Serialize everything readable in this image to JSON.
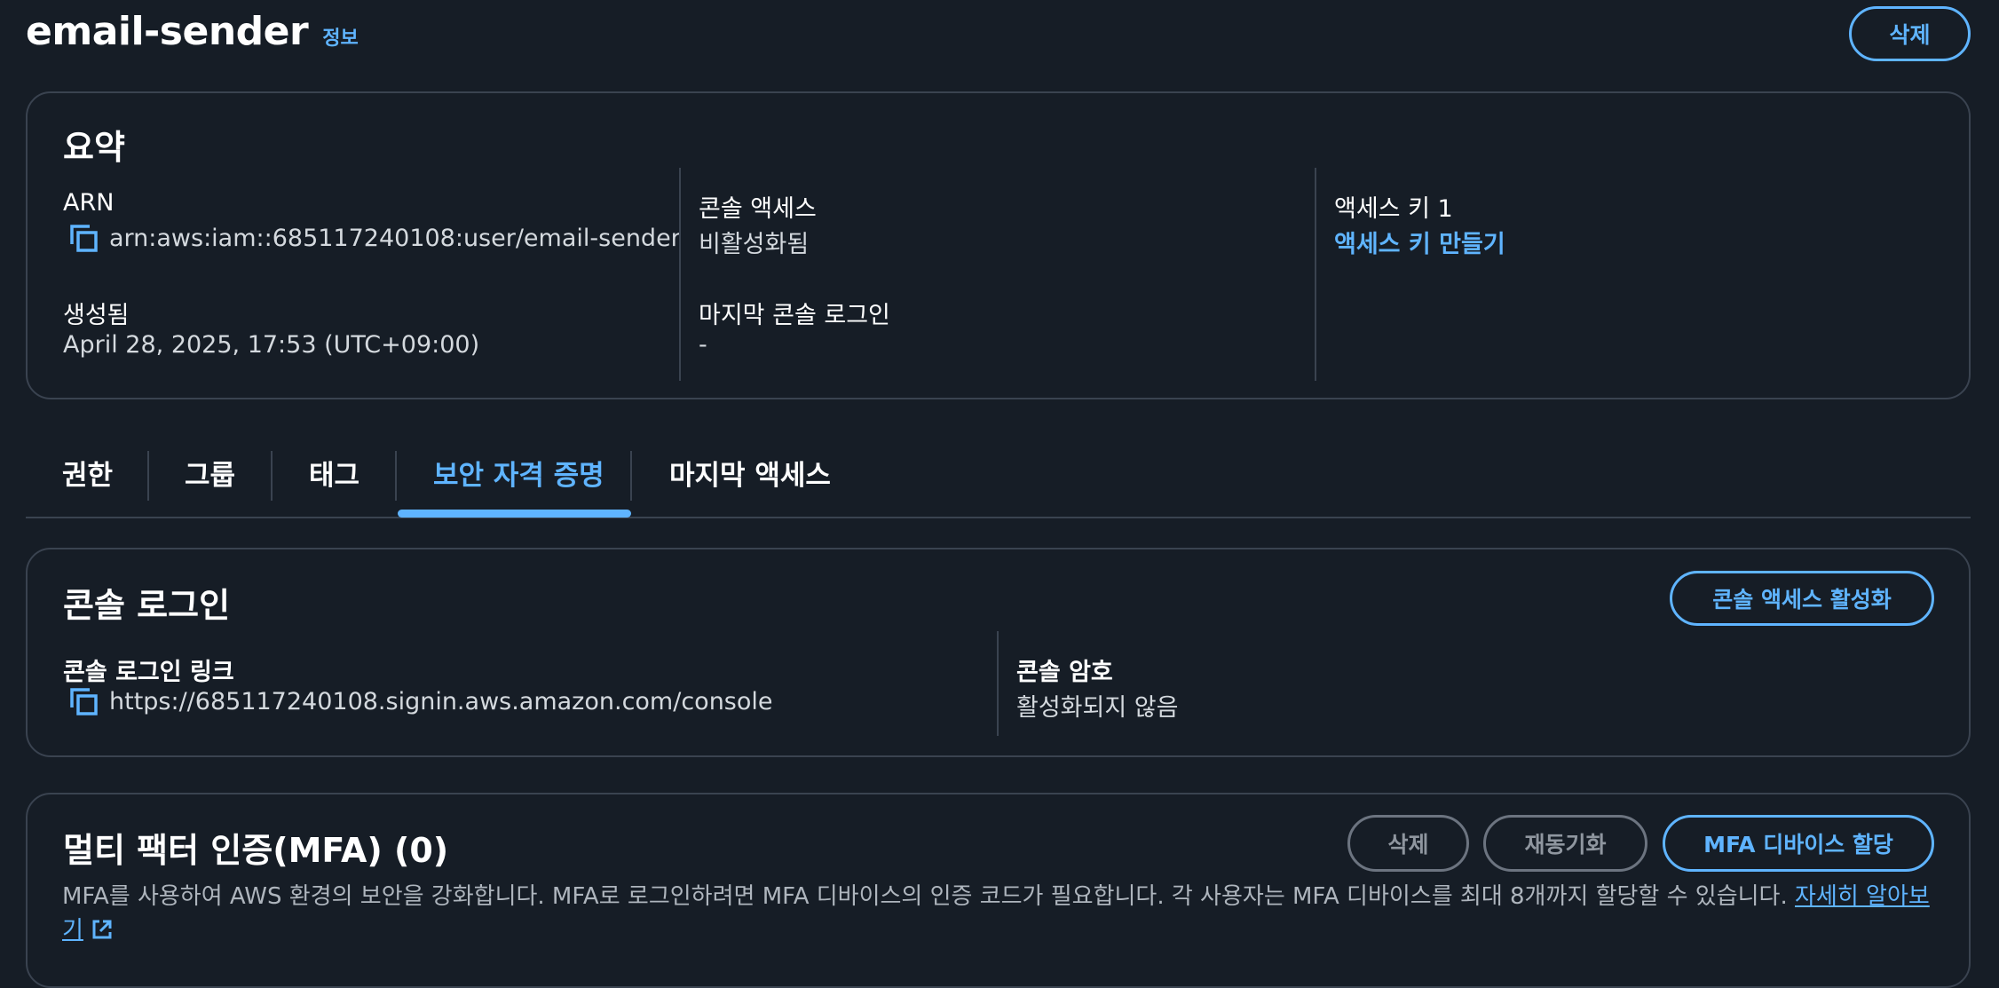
{
  "header": {
    "title": "email-sender",
    "info_label": "정보",
    "delete_button": "삭제"
  },
  "summary": {
    "title": "요약",
    "arn_label": "ARN",
    "arn_value": "arn:aws:iam::685117240108:user/email-sender",
    "created_label": "생성됨",
    "created_value": "April 28, 2025, 17:53 (UTC+09:00)",
    "console_access_label": "콘솔 액세스",
    "console_access_value": "비활성화됨",
    "last_console_login_label": "마지막 콘솔 로그인",
    "last_console_login_value": "-",
    "access_key_label": "액세스 키 1",
    "create_access_key_link": "액세스 키 만들기"
  },
  "tabs": [
    {
      "label": "권한"
    },
    {
      "label": "그룹"
    },
    {
      "label": "태그"
    },
    {
      "label": "보안 자격 증명"
    },
    {
      "label": "마지막 액세스"
    }
  ],
  "active_tab": "보안 자격 증명",
  "console_login": {
    "title": "콘솔 로그인",
    "enable_button": "콘솔 액세스 활성화",
    "link_label": "콘솔 로그인 링크",
    "link_value": "https://685117240108.signin.aws.amazon.com/console",
    "password_label": "콘솔 암호",
    "password_value": "활성화되지 않음"
  },
  "mfa": {
    "title": "멀티 팩터 인증(MFA) (0)",
    "delete_button": "삭제",
    "resync_button": "재동기화",
    "assign_button": "MFA 디바이스 할당",
    "description": "MFA를 사용하여 AWS 환경의 보안을 강화합니다. MFA로 로그인하려면 MFA 디바이스의 인증 코드가 필요합니다. 각 사용자는 MFA 디바이스를 최대 8개까지 할당할 수 있습니다.",
    "learn_more_link": "자세히 알아보기"
  },
  "colors": {
    "background": "#161d26",
    "accent": "#5fb4ff",
    "border": "#3a4350"
  }
}
